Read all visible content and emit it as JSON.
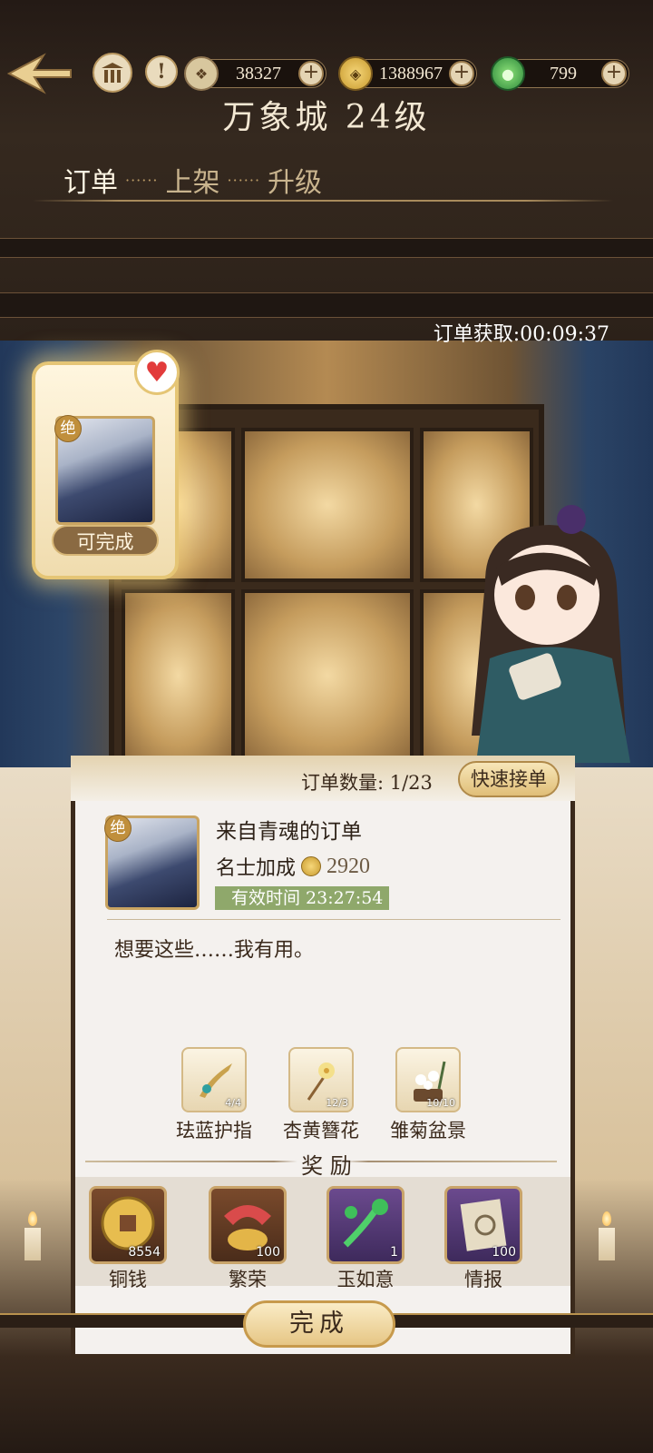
{
  "header": {
    "title": "万象城 24级",
    "resources": [
      {
        "icon": "scroll-icon",
        "value": "38327"
      },
      {
        "icon": "coin-icon",
        "value": "1388967"
      },
      {
        "icon": "jade-icon",
        "value": "799"
      }
    ],
    "plus": "+",
    "info_glyph": "!"
  },
  "tabs": [
    {
      "label": "订单",
      "active": true
    },
    {
      "label": "上架",
      "active": false
    },
    {
      "label": "升级",
      "active": false
    }
  ],
  "tab_separator": "······",
  "order_timer": "订单获取:00:09:37",
  "order_card": {
    "rarity": "绝",
    "status": "可完成"
  },
  "panel": {
    "order_count": "订单数量: 1/23",
    "quick_button": "快速接单",
    "order": {
      "rarity": "绝",
      "title": "来自青魂的订单",
      "bonus_label": "名士加成",
      "bonus_value": "2920",
      "valid_time": "有效时间 23:27:54",
      "description": "想要这些……我有用。"
    },
    "required_items": [
      {
        "name": "珐蓝护指",
        "count": "4/4"
      },
      {
        "name": "杏黄簪花",
        "count": "12/3"
      },
      {
        "name": "雏菊盆景",
        "count": "10/10"
      }
    ],
    "reward_title": "奖 励",
    "rewards": [
      {
        "name": "铜钱",
        "count": "8554"
      },
      {
        "name": "繁荣",
        "count": "100"
      },
      {
        "name": "玉如意",
        "count": "1"
      },
      {
        "name": "情报",
        "count": "100"
      }
    ],
    "complete_button": "完成"
  },
  "colors": {
    "accent_gold": "#e5c575",
    "valid_green": "#8fa86b",
    "heart_red": "#e23b3b"
  }
}
